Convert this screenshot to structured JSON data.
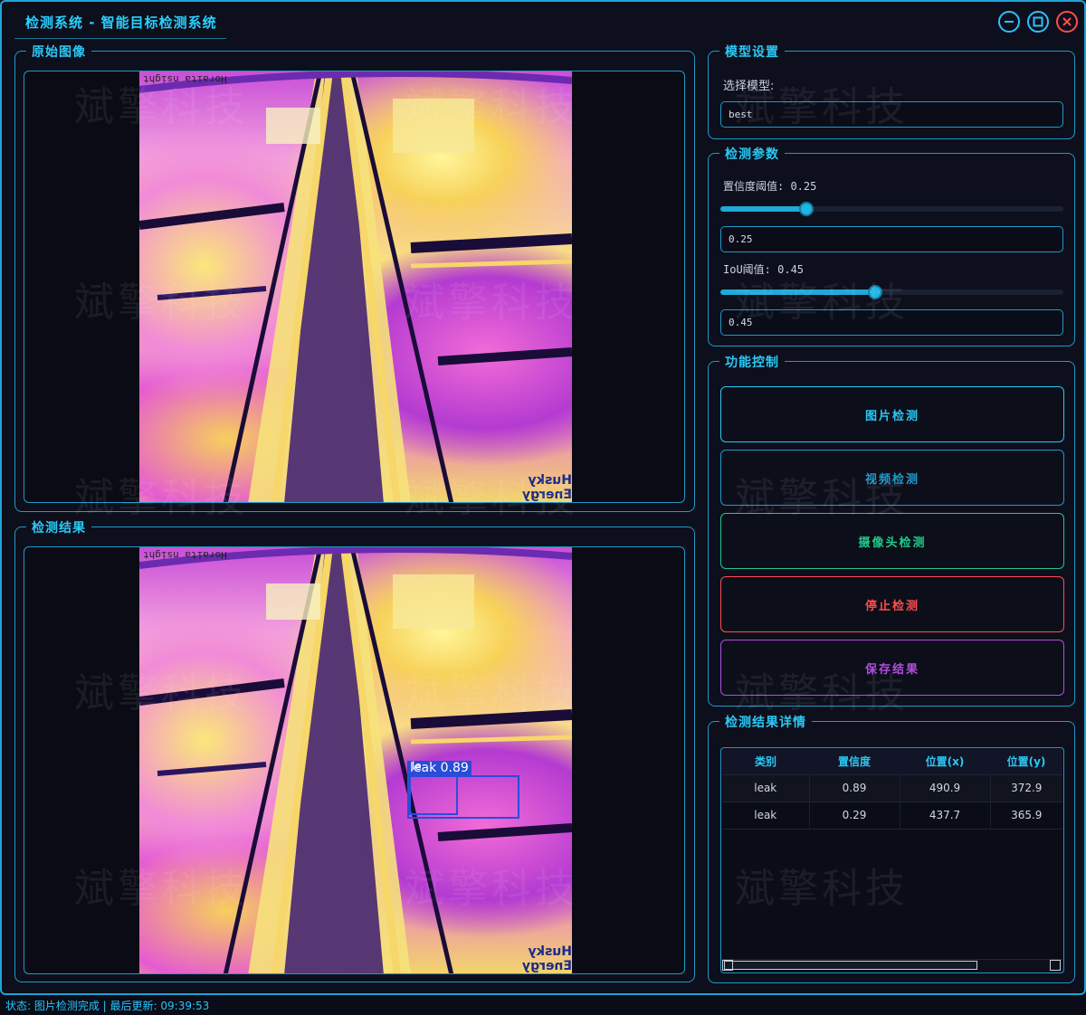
{
  "window": {
    "title": "检测系统 - 智能目标检测系统",
    "controls": [
      "minimize-icon",
      "maximize-icon",
      "close-icon"
    ]
  },
  "watermark": "斌擎科技",
  "original_panel": {
    "title": "原始图像",
    "image_text_top": "Horaita nsight",
    "image_text_bottom": "Husky Energy"
  },
  "result_panel": {
    "title": "检测结果",
    "image_text_top": "Horaita nsight",
    "image_text_bottom": "Husky Energy",
    "detections": [
      {
        "label": "leak 0.89"
      },
      {
        "label": "le"
      }
    ]
  },
  "model_settings": {
    "title": "模型设置",
    "select_label": "选择模型:",
    "selected_model": "best"
  },
  "detect_params": {
    "title": "检测参数",
    "conf_label": "置信度阈值: 0.25",
    "conf_value": "0.25",
    "conf_fraction": 0.25,
    "iou_label": "IoU阈值: 0.45",
    "iou_value": "0.45",
    "iou_fraction": 0.45
  },
  "function_control": {
    "title": "功能控制",
    "buttons": [
      {
        "label": "图片检测",
        "color": "#2bc8f5"
      },
      {
        "label": "视频检测",
        "color": "#1f9ac8"
      },
      {
        "label": "摄像头检测",
        "color": "#1fc98a"
      },
      {
        "label": "停止检测",
        "color": "#ff4d4d"
      },
      {
        "label": "保存结果",
        "color": "#b34de0"
      }
    ]
  },
  "result_details": {
    "title": "检测结果详情",
    "columns": [
      "类别",
      "置信度",
      "位置(x)",
      "位置(y)"
    ],
    "rows": [
      [
        "leak",
        "0.89",
        "490.9",
        "372.9"
      ],
      [
        "leak",
        "0.29",
        "437.7",
        "365.9"
      ]
    ]
  },
  "status": {
    "text": "状态: 图片检测完成 | 最后更新: 09:39:53"
  },
  "colors": {
    "accent": "#1f9ac8",
    "title": "#2bc8f5",
    "stop": "#ff4d4d",
    "save": "#b34de0",
    "camera": "#1fc98a"
  }
}
